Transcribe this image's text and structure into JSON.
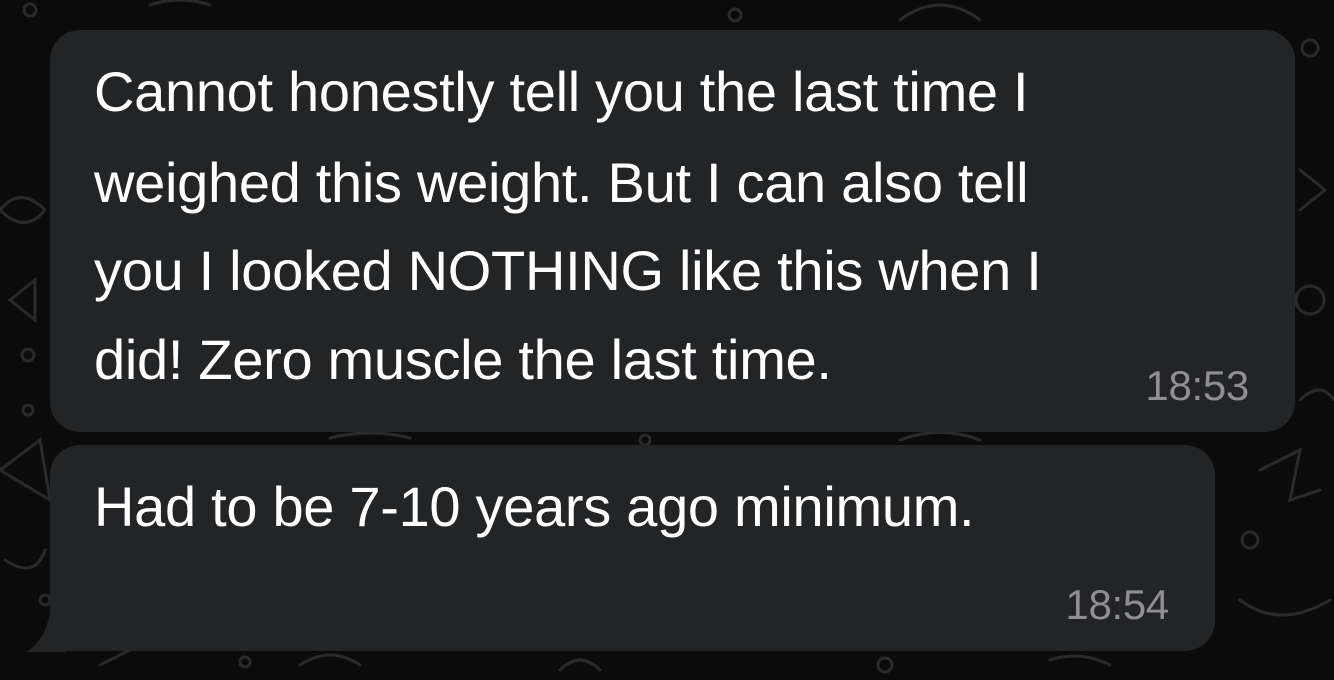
{
  "colors": {
    "background": "#0b0b0b",
    "bubble": "#232426",
    "text": "#ffffff",
    "timestamp": "#8e8e93"
  },
  "messages": [
    {
      "lines": [
        "Cannot honestly tell you the last time I",
        "weighed this weight. But I can also tell",
        "you I looked NOTHING like this when I",
        "did! Zero muscle the last time."
      ],
      "time": "18:53"
    },
    {
      "lines": [
        "Had to be 7-10 years ago minimum."
      ],
      "time": "18:54"
    }
  ]
}
